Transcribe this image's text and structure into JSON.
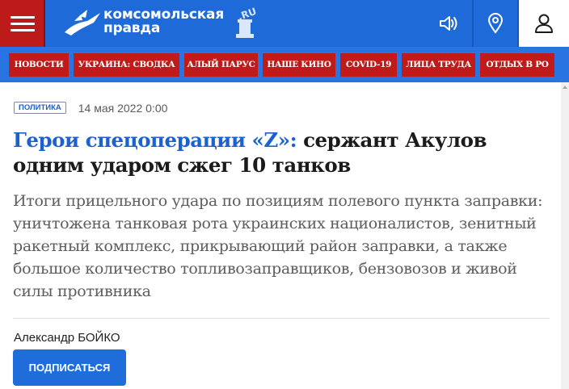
{
  "header": {
    "logo_line1": "комсомольская",
    "logo_line2": "правда",
    "logo_badge": ".RU",
    "icons": [
      "menu-icon",
      "kp-bird-logo",
      "sound-icon",
      "location-pin-icon",
      "user-icon"
    ],
    "colors": {
      "header_blue": "#1d6ad8",
      "menu_red": "#bd1a1a"
    }
  },
  "nav": {
    "items": [
      "НОВОСТИ",
      "УКРАИНА: СВОДКА",
      "АЛЫЙ ПАРУС",
      "НАШЕ КИНО",
      "COVID-19",
      "ЛИЦА ТРУДА",
      "ОТДЫХ В РО"
    ],
    "colors": {
      "nav_blue": "#2874e1",
      "tag_red": "#c11a1a"
    }
  },
  "article": {
    "rubric": "ПОЛИТИКА",
    "date": "14 мая 2022 0:00",
    "headline_kicker": "Герои спецоперации «Z»:",
    "headline_rest": " сержант Акулов одним ударом сжег 10 танков",
    "lead": "Итоги прицельного удара по позициям полевого пункта заправки: уничтожена танковая рота украинских националистов, зенитный ракетный комплекс, прикрывающий район заправки, а также большое количество топливозаправщиков, бензовозов и живой силы противника",
    "author": "Александр БОЙКО",
    "subscribe_label": "ПОДПИСАТЬСЯ",
    "colors": {
      "kicker_blue": "#1c62cf",
      "button_blue": "#1e6ddb"
    }
  }
}
